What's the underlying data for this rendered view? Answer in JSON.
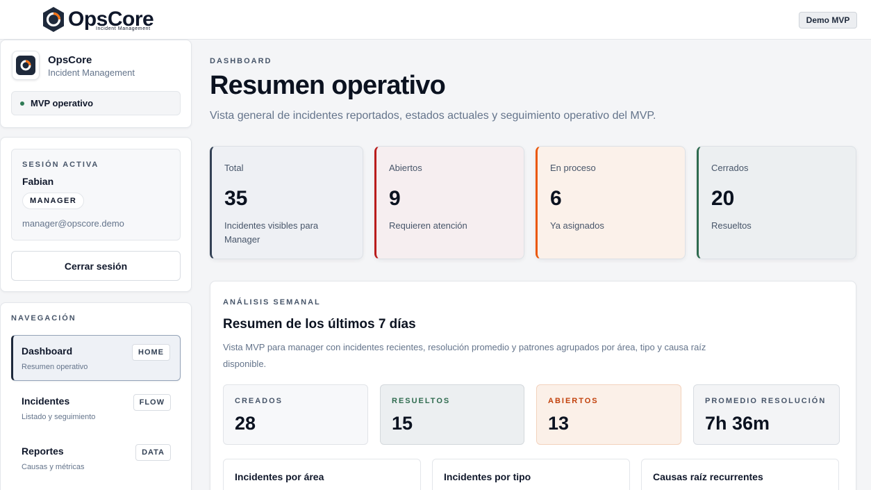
{
  "topbar": {
    "brand_name": "OpsCore",
    "brand_tagline": "Incident Management",
    "demo_label": "Demo MVP"
  },
  "sidebar": {
    "app_title": "OpsCore",
    "app_subtitle": "Incident Management",
    "status_label": "MVP operativo",
    "session": {
      "eyebrow": "SESIÓN ACTIVA",
      "user_name": "Fabian",
      "role": "MANAGER",
      "email": "manager@opscore.demo",
      "logout_label": "Cerrar sesión"
    },
    "nav_eyebrow": "NAVEGACIÓN",
    "nav_items": [
      {
        "label": "Dashboard",
        "desc": "Resumen operativo",
        "tag": "HOME"
      },
      {
        "label": "Incidentes",
        "desc": "Listado y seguimiento",
        "tag": "FLOW"
      },
      {
        "label": "Reportes",
        "desc": "Causas y métricas",
        "tag": "DATA"
      }
    ]
  },
  "main": {
    "eyebrow": "DASHBOARD",
    "title": "Resumen operativo",
    "description": "Vista general de incidentes reportados, estados actuales y seguimiento operativo del MVP.",
    "stats": [
      {
        "label": "Total",
        "value": "35",
        "note": "Incidentes visibles para Manager",
        "accent": "#334155"
      },
      {
        "label": "Abiertos",
        "value": "9",
        "note": "Requieren atención",
        "accent": "#b91c1c"
      },
      {
        "label": "En proceso",
        "value": "6",
        "note": "Ya asignados",
        "accent": "#ea580c"
      },
      {
        "label": "Cerrados",
        "value": "20",
        "note": "Resueltos",
        "accent": "#2f6b4f"
      }
    ],
    "weekly": {
      "eyebrow": "ANÁLISIS SEMANAL",
      "title": "Resumen de los últimos 7 días",
      "description": "Vista MVP para manager con incidentes recientes, resolución promedio y patrones agrupados por área, tipo y causa raíz disponible.",
      "metrics": [
        {
          "label": "CREADOS",
          "value": "28",
          "color": "#475569"
        },
        {
          "label": "RESUELTOS",
          "value": "15",
          "color": "#2f6b4f"
        },
        {
          "label": "ABIERTOS",
          "value": "13",
          "color": "#c2410c"
        },
        {
          "label": "PROMEDIO RESOLUCIÓN",
          "value": "7h 36m",
          "color": "#475569"
        }
      ],
      "breakdowns": [
        {
          "title": "Incidentes por área"
        },
        {
          "title": "Incidentes por tipo"
        },
        {
          "title": "Causas raíz recurrentes"
        }
      ]
    }
  }
}
